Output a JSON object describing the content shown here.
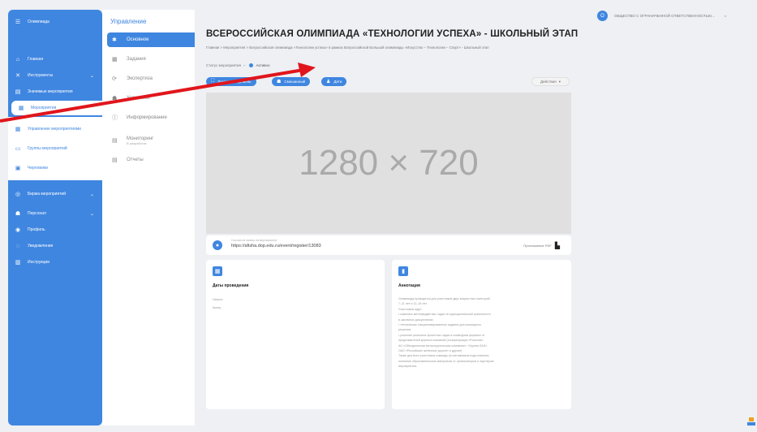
{
  "sidebar": {
    "app_label": "Олимпиада",
    "items": [
      {
        "label": "Главная",
        "icon": "home-icon"
      },
      {
        "label": "Инструменты",
        "icon": "tools-icon",
        "chevron": true
      },
      {
        "label": "Значимые мероприятия",
        "icon": "list-icon"
      },
      {
        "label": "Мероприятия",
        "icon": "calendar-icon",
        "chevron": true
      },
      {
        "label": "Управление мероприятиями",
        "icon": "calendar-icon"
      },
      {
        "label": "Группы мероприятий",
        "icon": "folder-icon"
      },
      {
        "label": "Черновики",
        "icon": "draft-icon"
      },
      {
        "label": "Биржа мероприятий",
        "icon": "exchange-icon",
        "chevron": true
      },
      {
        "label": "Персонал",
        "icon": "people-icon",
        "chevron": true
      },
      {
        "label": "Профиль",
        "icon": "profile-icon"
      },
      {
        "label": "Уведомления",
        "icon": "bell-icon"
      },
      {
        "label": "Инструкции",
        "icon": "book-icon"
      }
    ]
  },
  "panel2": {
    "title": "Управление",
    "items": [
      {
        "label": "Основное",
        "icon": "settings-icon",
        "active": true
      },
      {
        "label": "Задания",
        "icon": "tasks-icon"
      },
      {
        "label": "Экспертиза",
        "icon": "expertise-icon"
      },
      {
        "label": "Участники",
        "icon": "participants-icon"
      },
      {
        "label": "Информирование",
        "icon": "info-icon"
      },
      {
        "label": "Мониторинг",
        "sub": "В разработке",
        "icon": "monitor-icon"
      },
      {
        "label": "Отчеты",
        "icon": "reports-icon"
      }
    ]
  },
  "header": {
    "title": "ВСЕРОССИЙСКАЯ ОЛИМПИАДА «ТЕХНОЛОГИИ УСПЕХА» - ШКОЛЬНЫЙ ЭТАП",
    "breadcrumb": "Главная   >   Мероприятия   >   Всероссийская олимпиада «Технологии успеха» в рамках Всероссийской Большой олимпиады «Искусство – Технологии – Спорт» - Школьный этап",
    "status_label": "Статус мероприятия",
    "status_value": "Активно",
    "org_name": "ОБЩЕСТВО С ОГРАНИЧЕННОЙ ОТВЕТСТВЕННОСТЬЮ...",
    "org_avatar": "О"
  },
  "buttons": {
    "level": "Локальный уровень",
    "type": "Смешанный",
    "audience": "Дети",
    "actions": "Действия"
  },
  "media": {
    "placeholder": "1280 × 720"
  },
  "registration": {
    "caption": "Ссылка на запись на мероприятие",
    "link": "https://afisha.dop.edu.ru/event/register/13083",
    "pdf_label": "Приглашение PDF"
  },
  "dates_card": {
    "title": "Даты проведения",
    "lines": [
      "Начало",
      "Конец"
    ]
  },
  "annotation_card": {
    "title": "Аннотация",
    "lines": [
      "Олимпиада проводится для участников двух возрастных категорий:",
      "7–11 лет и 12–18 лет.",
      "Участников ждут:",
      "• комплекс метапредметных задач по функциональной грамотности",
      "  в школьных дисциплинах;",
      "• технические специализированные задания для командного",
      "  решения;",
      "• решение реальных проектных задач в командном формате от",
      "  представителей крупных компаний (госкорпорации «Росатом»,",
      "  АО «Объединенная металлургическая компания», «Группа ЛАЭ»,",
      "  ОАО «Российские железные дороги» и другие).",
      "Также для всех участников команды из наставников подготовлены",
      "полезные образовательные материалы от организаторов и партнеров",
      "мероприятия."
    ]
  },
  "colors": {
    "accent": "#3f86e0",
    "arrow": "#e0161c"
  }
}
